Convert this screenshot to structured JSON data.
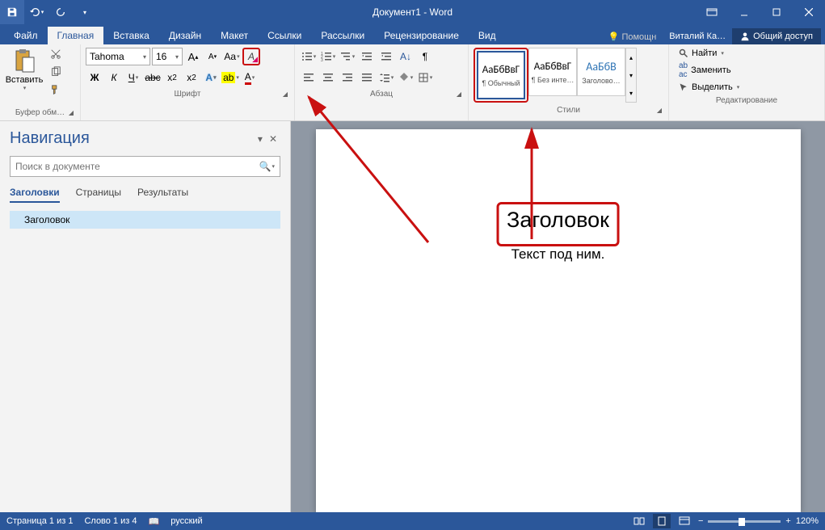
{
  "titlebar": {
    "title": "Документ1 - Word"
  },
  "tabs": {
    "file": "Файл",
    "home": "Главная",
    "insert": "Вставка",
    "design": "Дизайн",
    "layout": "Макет",
    "references": "Ссылки",
    "mailings": "Рассылки",
    "review": "Рецензирование",
    "view": "Вид",
    "tellme": "Помощн",
    "user": "Виталий Ка…",
    "share": "Общий доступ"
  },
  "ribbon": {
    "clipboard": {
      "label": "Буфер обм…",
      "paste": "Вставить"
    },
    "font": {
      "label": "Шрифт",
      "name": "Tahoma",
      "size": "16"
    },
    "paragraph": {
      "label": "Абзац"
    },
    "styles": {
      "label": "Стили",
      "items": [
        {
          "preview": "АаБбВвГ",
          "name": "¶ Обычный"
        },
        {
          "preview": "АаБбВвГ",
          "name": "¶ Без инте…"
        },
        {
          "preview": "АаБбВ",
          "name": "Заголово…"
        }
      ]
    },
    "editing": {
      "label": "Редактирование",
      "find": "Найти",
      "replace": "Заменить",
      "select": "Выделить"
    }
  },
  "nav": {
    "title": "Навигация",
    "placeholder": "Поиск в документе",
    "tabs": {
      "headings": "Заголовки",
      "pages": "Страницы",
      "results": "Результаты"
    },
    "items": [
      {
        "text": "Заголовок"
      }
    ]
  },
  "document": {
    "heading": "Заголовок",
    "body": "Текст под ним."
  },
  "statusbar": {
    "page": "Страница 1 из 1",
    "words": "Слово 1 из 4",
    "lang": "русский",
    "zoom": "120%"
  }
}
